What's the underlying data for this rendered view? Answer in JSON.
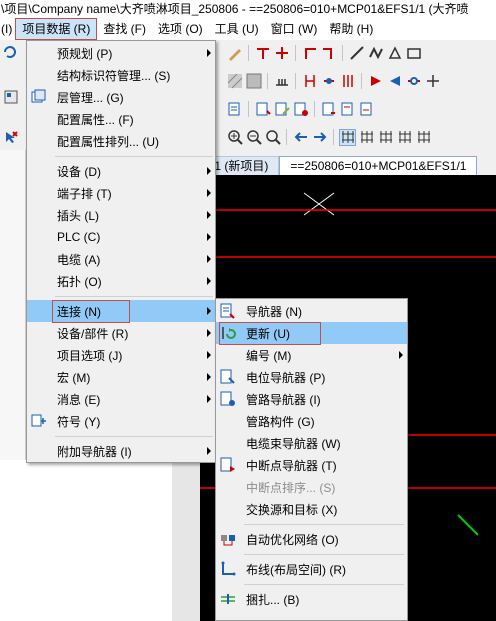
{
  "window": {
    "title": "\\项目\\Company name\\大齐喷淋项目_250806 - ==250806=010+MCP01&EFS1/1 (大齐喷"
  },
  "menubar": {
    "items": [
      {
        "label": "(I)"
      },
      {
        "label": "项目数据 (R)"
      },
      {
        "label": "查找 (F)"
      },
      {
        "label": "选项 (O)"
      },
      {
        "label": "工具 (U)"
      },
      {
        "label": "窗口 (W)"
      },
      {
        "label": "帮助 (H)"
      }
    ]
  },
  "tabs": [
    {
      "label": "/1 (新项目)"
    },
    {
      "label": "==250806=010+MCP01&EFS1/1"
    }
  ],
  "project_data_menu": {
    "items": [
      {
        "label": "预规划 (P)",
        "submenu": true,
        "icon": "none"
      },
      {
        "label": "结构标识符管理... (S)",
        "submenu": false,
        "icon": "none"
      },
      {
        "label": "层管理... (G)",
        "submenu": false,
        "icon": "layers-icon"
      },
      {
        "label": "配置属性... (F)",
        "submenu": false,
        "icon": "none"
      },
      {
        "label": "配置属性排列... (U)",
        "submenu": false,
        "icon": "none"
      },
      {
        "label": "设备 (D)",
        "submenu": true,
        "icon": "none"
      },
      {
        "label": "端子排 (T)",
        "submenu": true,
        "icon": "none"
      },
      {
        "label": "插头 (L)",
        "submenu": true,
        "icon": "none"
      },
      {
        "label": "PLC (C)",
        "submenu": true,
        "icon": "none"
      },
      {
        "label": "电缆 (A)",
        "submenu": true,
        "icon": "none"
      },
      {
        "label": "拓扑 (O)",
        "submenu": true,
        "icon": "none"
      },
      {
        "label": "连接 (N)",
        "submenu": true,
        "icon": "none"
      },
      {
        "label": "设备/部件 (R)",
        "submenu": true,
        "icon": "none"
      },
      {
        "label": "项目选项 (J)",
        "submenu": true,
        "icon": "none"
      },
      {
        "label": "宏 (M)",
        "submenu": true,
        "icon": "none"
      },
      {
        "label": "消息 (E)",
        "submenu": true,
        "icon": "none"
      },
      {
        "label": "符号 (Y)",
        "submenu": false,
        "icon": "symbol-icon"
      },
      {
        "label": "附加导航器 (I)",
        "submenu": true,
        "icon": "none"
      }
    ]
  },
  "connection_submenu": {
    "items": [
      {
        "label": "导航器 (N)",
        "submenu": false,
        "disabled": false,
        "icon": "navigator-icon"
      },
      {
        "label": "更新 (U)",
        "submenu": false,
        "disabled": false,
        "icon": "refresh-icon"
      },
      {
        "label": "编号 (M)",
        "submenu": true,
        "disabled": false,
        "icon": "none"
      },
      {
        "label": "电位导航器 (P)",
        "submenu": false,
        "disabled": false,
        "icon": "potential-navigator-icon"
      },
      {
        "label": "管路导航器 (I)",
        "submenu": false,
        "disabled": false,
        "icon": "pipe-navigator-icon"
      },
      {
        "label": "管路构件 (G)",
        "submenu": false,
        "disabled": false,
        "icon": "none"
      },
      {
        "label": "电缆束导航器 (W)",
        "submenu": false,
        "disabled": false,
        "icon": "none"
      },
      {
        "label": "中断点导航器 (T)",
        "submenu": false,
        "disabled": false,
        "icon": "interruption-navigator-icon"
      },
      {
        "label": "中断点排序... (S)",
        "submenu": false,
        "disabled": true,
        "icon": "none"
      },
      {
        "label": "交换源和目标 (X)",
        "submenu": false,
        "disabled": false,
        "icon": "none"
      },
      {
        "label": "自动优化网络 (O)",
        "submenu": false,
        "disabled": false,
        "icon": "network-optimize-icon"
      },
      {
        "label": "布线(布局空间) (R)",
        "submenu": false,
        "disabled": false,
        "icon": "routing-icon"
      },
      {
        "label": "捆扎... (B)",
        "submenu": false,
        "disabled": false,
        "icon": "bundle-icon"
      }
    ]
  },
  "colors": {
    "highlight": "#91c9f7",
    "red_outline": "#c2504a",
    "canvas_bg": "#000000",
    "red_line": "#ff0000",
    "green_line": "#00c800"
  }
}
